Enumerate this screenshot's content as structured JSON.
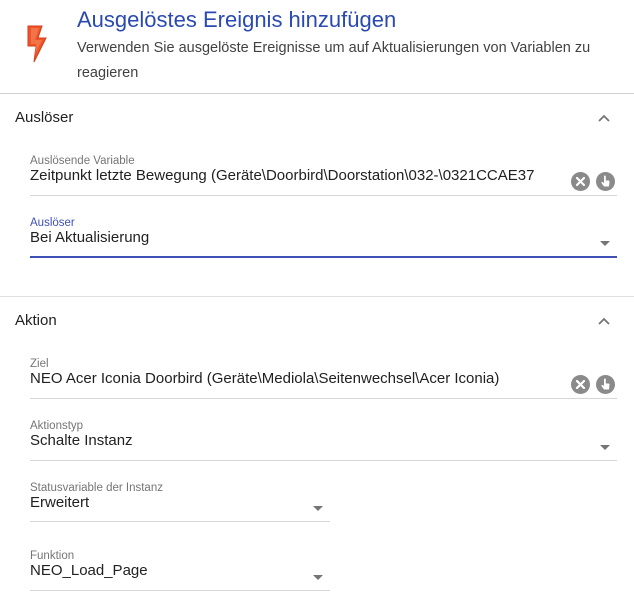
{
  "header": {
    "title": "Ausgelöstes Ereignis hinzufügen",
    "subtitle": "Verwenden Sie ausgelöste Ereignisse um auf Aktualisierungen von Variablen zu reagieren",
    "icon": "lightning-bolt-icon",
    "accent_color": "#2a4ab1",
    "icon_color": "#f0532a"
  },
  "trigger_section": {
    "title": "Auslöser",
    "variable_field": {
      "label": "Auslösende Variable",
      "value": "Zeitpunkt letzte Bewegung (Geräte\\Doorbird\\Doorstation\\032-\\0321CCAE37"
    },
    "trigger_field": {
      "label": "Auslöser",
      "value": "Bei Aktualisierung"
    }
  },
  "action_section": {
    "title": "Aktion",
    "target_field": {
      "label": "Ziel",
      "value": "NEO Acer Iconia Doorbird (Geräte\\Mediola\\Seitenwechsel\\Acer Iconia)"
    },
    "action_type_field": {
      "label": "Aktionstyp",
      "value": "Schalte Instanz"
    },
    "status_variable_field": {
      "label": "Statusvariable der Instanz",
      "value": "Erweitert"
    },
    "function_field": {
      "label": "Funktion",
      "value": "NEO_Load_Page"
    }
  }
}
